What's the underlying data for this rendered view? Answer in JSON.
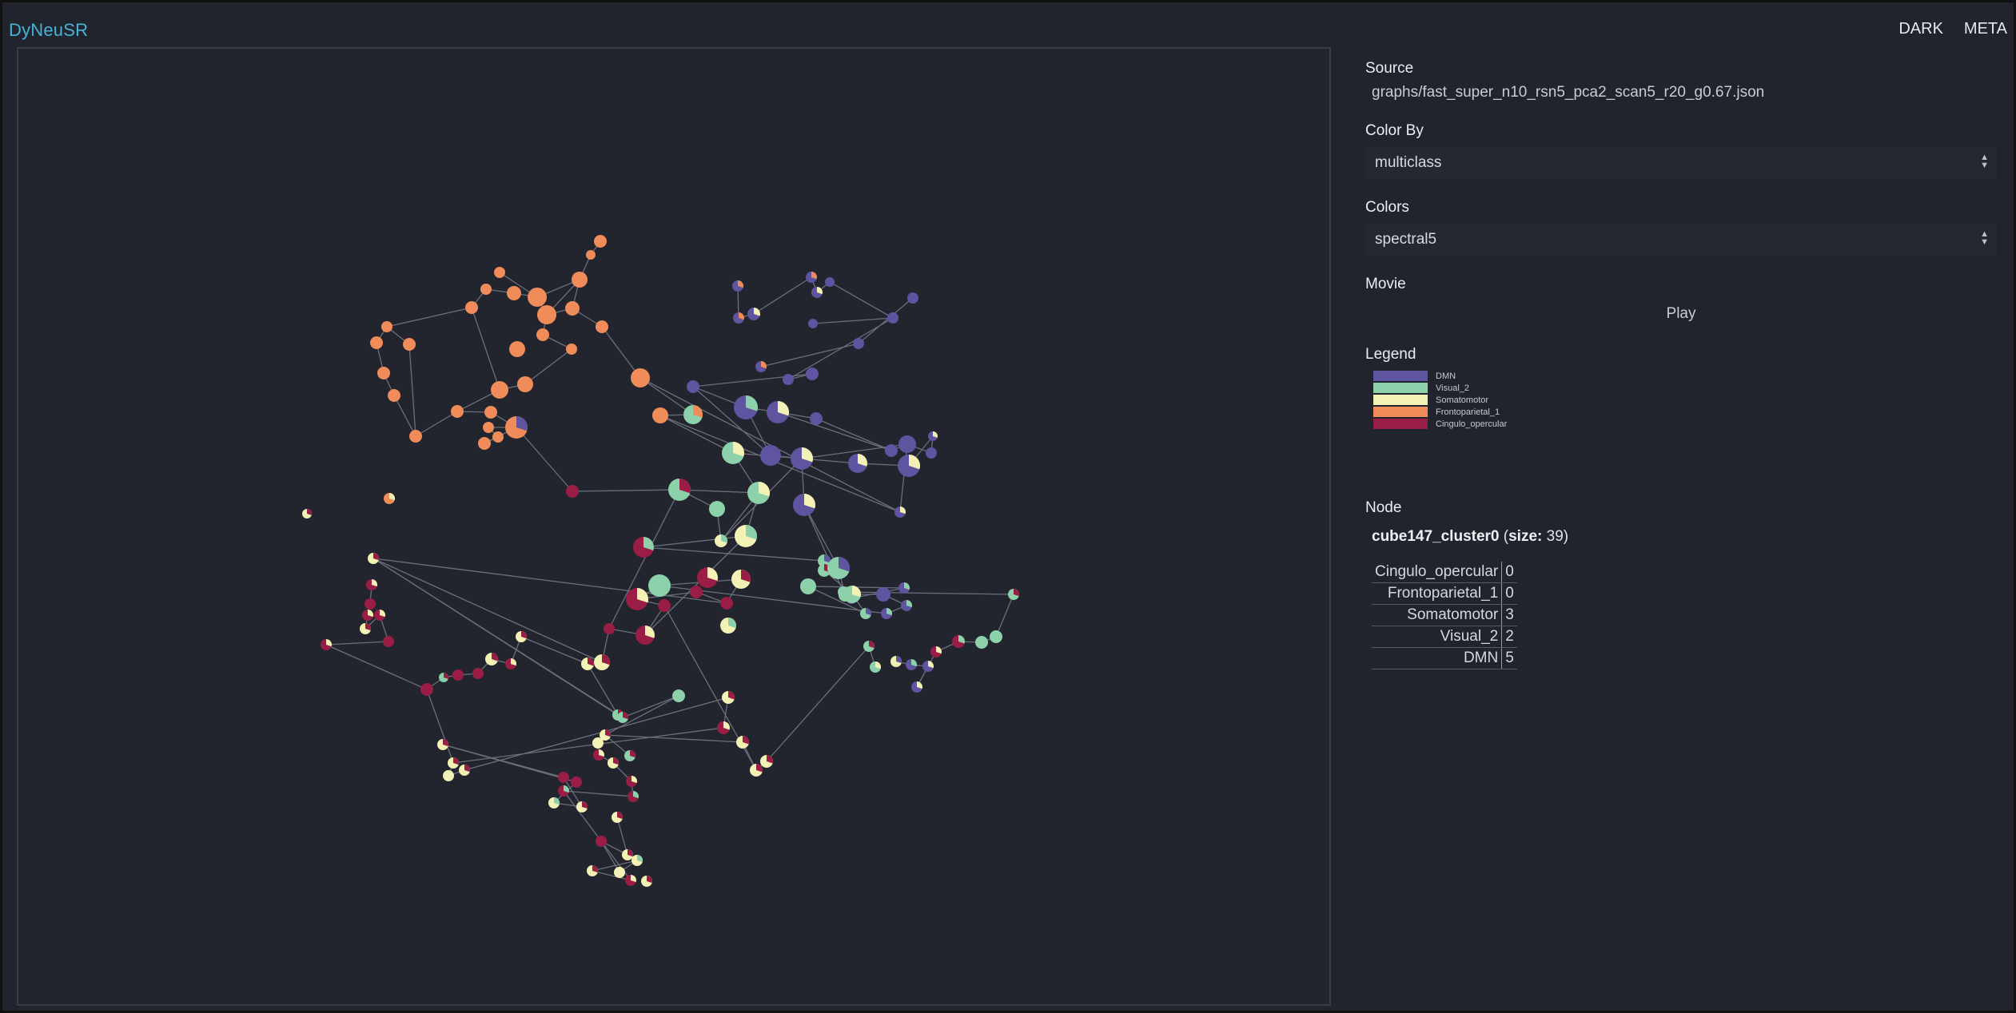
{
  "app": {
    "title": "DyNeuSR",
    "nav": [
      "DARK",
      "META"
    ]
  },
  "sidebar": {
    "source_title": "Source",
    "source_value": "graphs/fast_super_n10_rsn5_pca2_scan5_r20_g0.67.json",
    "color_by_title": "Color By",
    "color_by_value": "multiclass",
    "colors_title": "Colors",
    "colors_value": "spectral5",
    "movie_title": "Movie",
    "play_label": "Play",
    "legend_title": "Legend",
    "legend": [
      {
        "label": "DMN",
        "color": "#5e54a0"
      },
      {
        "label": "Visual_2",
        "color": "#8cd1a9"
      },
      {
        "label": "Somatomotor",
        "color": "#f4f1b4"
      },
      {
        "label": "Frontoparietal_1",
        "color": "#f08b5a"
      },
      {
        "label": "Cingulo_opercular",
        "color": "#9a1d45"
      }
    ],
    "node_title": "Node",
    "node_name": "cube147_cluster0",
    "node_size_label": "size:",
    "node_size_value": "39",
    "node_table": [
      {
        "k": "Cingulo_opercular",
        "v": "0"
      },
      {
        "k": "Frontoparietal_1",
        "v": "0"
      },
      {
        "k": "Somatomotor",
        "v": "3"
      },
      {
        "k": "Visual_2",
        "v": "2"
      },
      {
        "k": "DMN",
        "v": "5"
      }
    ]
  }
}
